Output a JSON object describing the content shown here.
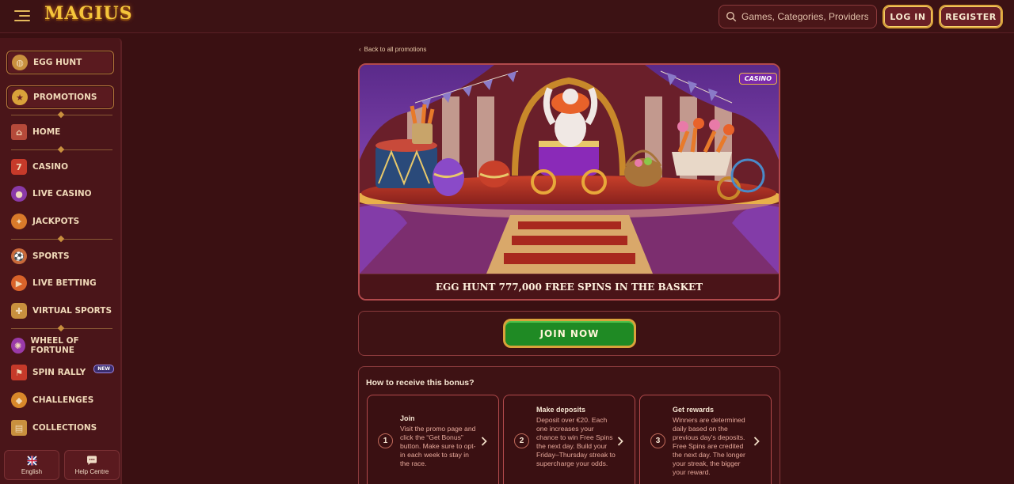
{
  "header": {
    "logo_text": "MAGIUS",
    "search_placeholder": "Games, Categories, Providers",
    "login_label": "LOG IN",
    "register_label": "REGISTER"
  },
  "sidebar": {
    "items": [
      {
        "label": "EGG HUNT",
        "icon": "egg-icon"
      },
      {
        "label": "PROMOTIONS",
        "icon": "gift-icon"
      },
      {
        "label": "HOME",
        "icon": "home-icon"
      },
      {
        "label": "CASINO",
        "icon": "slots-icon"
      },
      {
        "label": "LIVE CASINO",
        "icon": "live-casino-icon"
      },
      {
        "label": "JACKPOTS",
        "icon": "jackpot-icon"
      },
      {
        "label": "SPORTS",
        "icon": "sports-icon"
      },
      {
        "label": "LIVE BETTING",
        "icon": "live-betting-icon"
      },
      {
        "label": "VIRTUAL SPORTS",
        "icon": "gamepad-icon"
      },
      {
        "label": "WHEEL OF FORTUNE",
        "icon": "wheel-icon"
      },
      {
        "label": "SPIN RALLY",
        "icon": "flag-icon",
        "badge": "NEW"
      },
      {
        "label": "CHALLENGES",
        "icon": "challenges-icon"
      },
      {
        "label": "COLLECTIONS",
        "icon": "collections-icon"
      }
    ],
    "language_label": "English",
    "help_label": "Help Centre"
  },
  "promo": {
    "back_label": "Back to all promotions",
    "tag": "CASINO",
    "title": "EGG HUNT 777,000 FREE SPINS IN THE BASKET",
    "join_label": "JOIN NOW",
    "how_title": "How to receive this bonus?",
    "steps": [
      {
        "num": "1",
        "title": "Join",
        "desc": "Visit the promo page and click the “Get Bonus” button. Make sure to opt-in each week to stay in the race."
      },
      {
        "num": "2",
        "title": "Make deposits",
        "desc": "Deposit over €20. Each one increases your chance to win Free Spins the next day. Build your Friday–Thursday streak to supercharge your odds."
      },
      {
        "num": "3",
        "title": "Get rewards",
        "desc": "Winners are determined daily based on the previous day's deposits. Free Spins are credited the next day. The longer your streak, the bigger your reward."
      }
    ]
  },
  "colors": {
    "background": "#3a1012",
    "accent_gold": "#d9a23a",
    "join_green": "#1f8a24",
    "step_text": "#e6a89a"
  }
}
